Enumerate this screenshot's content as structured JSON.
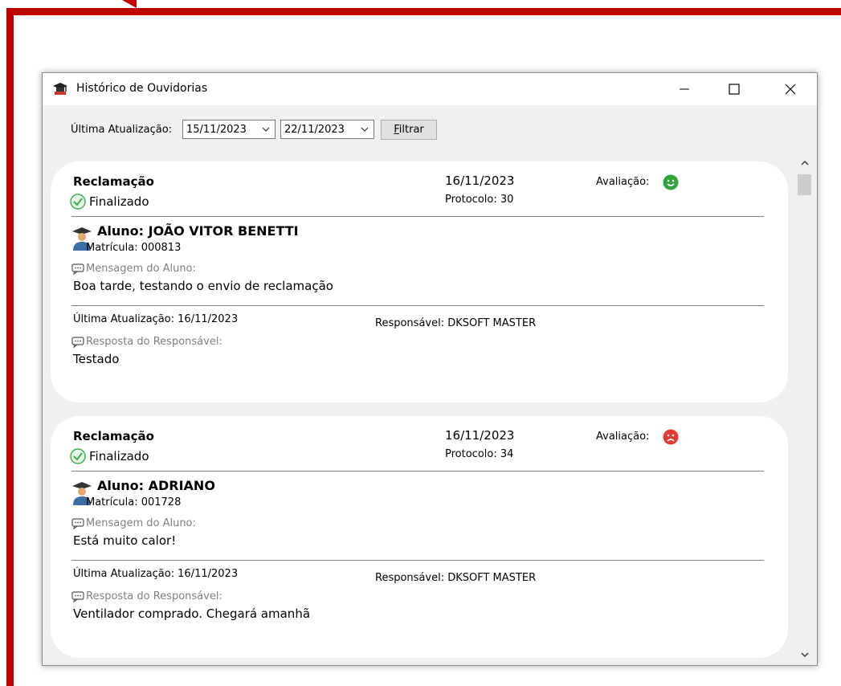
{
  "window": {
    "title": "Histórico de Ouvidorias",
    "app_icon": "graduation-cap-icon"
  },
  "toolbar": {
    "label": "Última Atualização:",
    "date_from": "15/11/2023",
    "date_to": "22/11/2023",
    "filter_label": "Filtrar"
  },
  "colors": {
    "frame": "#c00000",
    "success_green": "#3cae4e",
    "happy_green": "#2ea43b",
    "sad_red": "#e53935"
  },
  "tickets": [
    {
      "type": "Reclamação",
      "status": "Finalizado",
      "date": "16/11/2023",
      "protocol": "Protocolo: 30",
      "rating_label": "Avaliação:",
      "rating": "happy-face-icon",
      "student": "Aluno:  JOÃO VITOR BENETTI",
      "matricula": "Matrícula: 000813",
      "message_label": "Mensagem do Aluno:",
      "message": "Boa tarde, testando o envio de reclamação",
      "last_update": "Última Atualização: 16/11/2023",
      "responsible": "Responsável: DKSOFT MASTER",
      "response_label": "Resposta do Responsável:",
      "response": "Testado"
    },
    {
      "type": "Reclamação",
      "status": "Finalizado",
      "date": "16/11/2023",
      "protocol": "Protocolo: 34",
      "rating_label": "Avaliação:",
      "rating": "sad-face-icon",
      "student": "Aluno:  ADRIANO",
      "matricula": "Matrícula: 001728",
      "message_label": "Mensagem do Aluno:",
      "message": "Está muito calor!",
      "last_update": "Última Atualização: 16/11/2023",
      "responsible": "Responsável: DKSOFT MASTER",
      "response_label": "Resposta do Responsável:",
      "response": "Ventilador comprado. Chegará amanhã"
    }
  ]
}
